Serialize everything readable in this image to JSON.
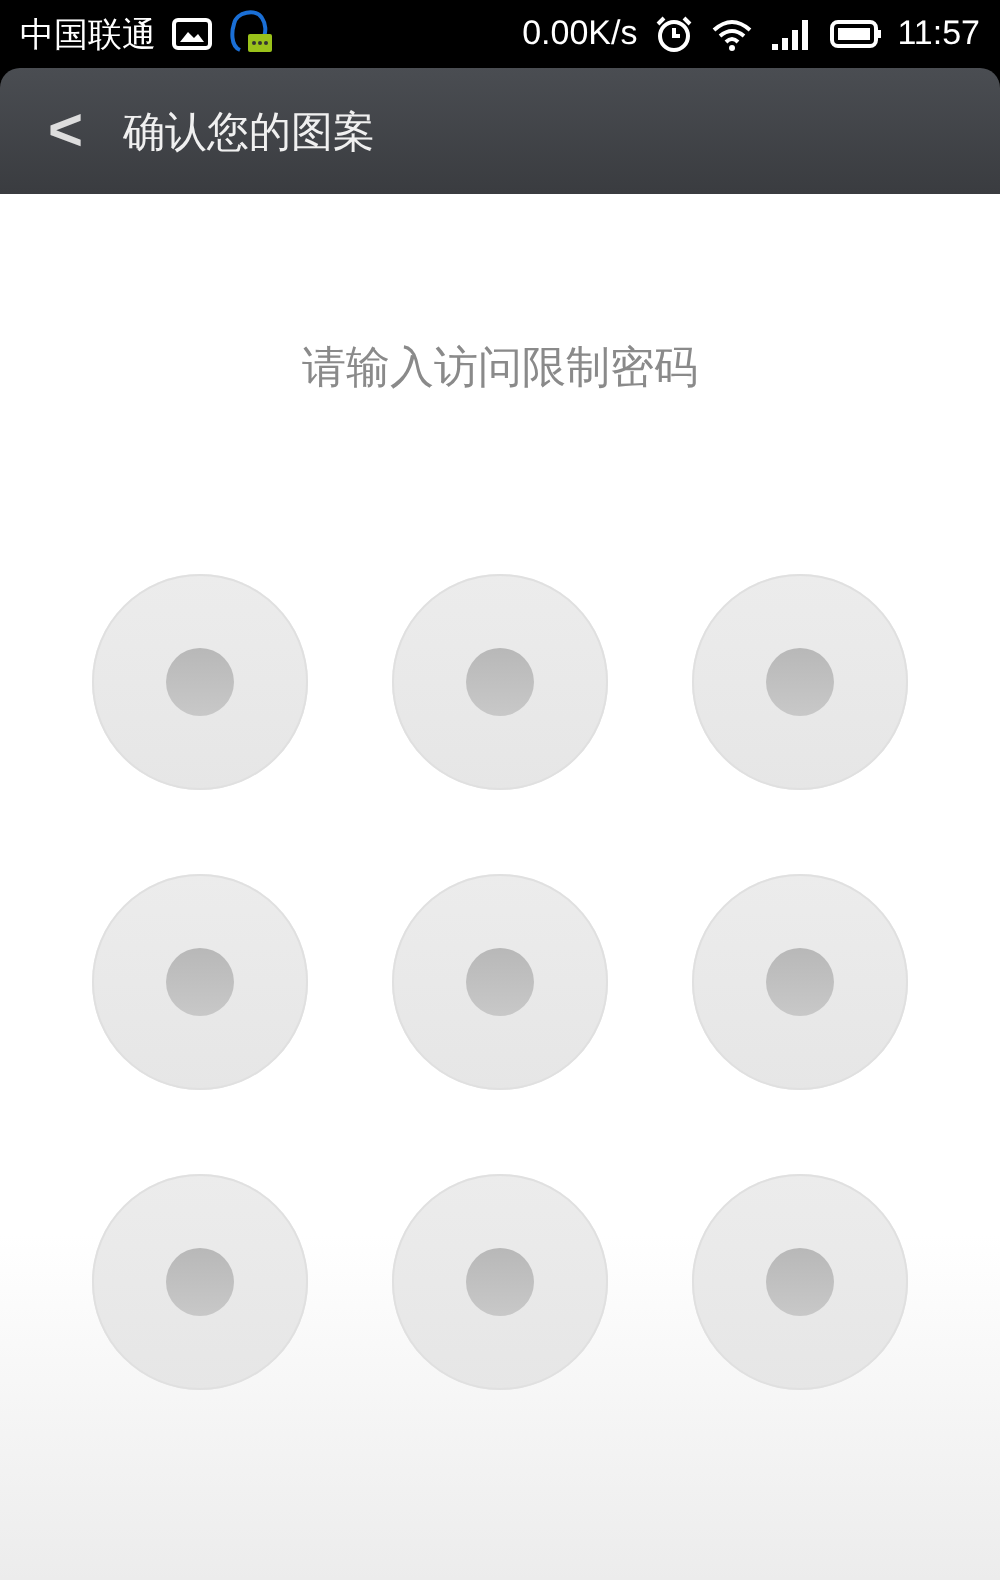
{
  "status_bar": {
    "carrier": "中国联通",
    "speed": "0.00K/s",
    "time": "11:57"
  },
  "title_bar": {
    "back": "<",
    "title": "确认您的图案"
  },
  "prompt": "请输入访问限制密码",
  "pattern_dots": [
    {
      "selected": false
    },
    {
      "selected": false
    },
    {
      "selected": false
    },
    {
      "selected": false
    },
    {
      "selected": false
    },
    {
      "selected": false
    },
    {
      "selected": false
    },
    {
      "selected": false
    },
    {
      "selected": false
    }
  ]
}
